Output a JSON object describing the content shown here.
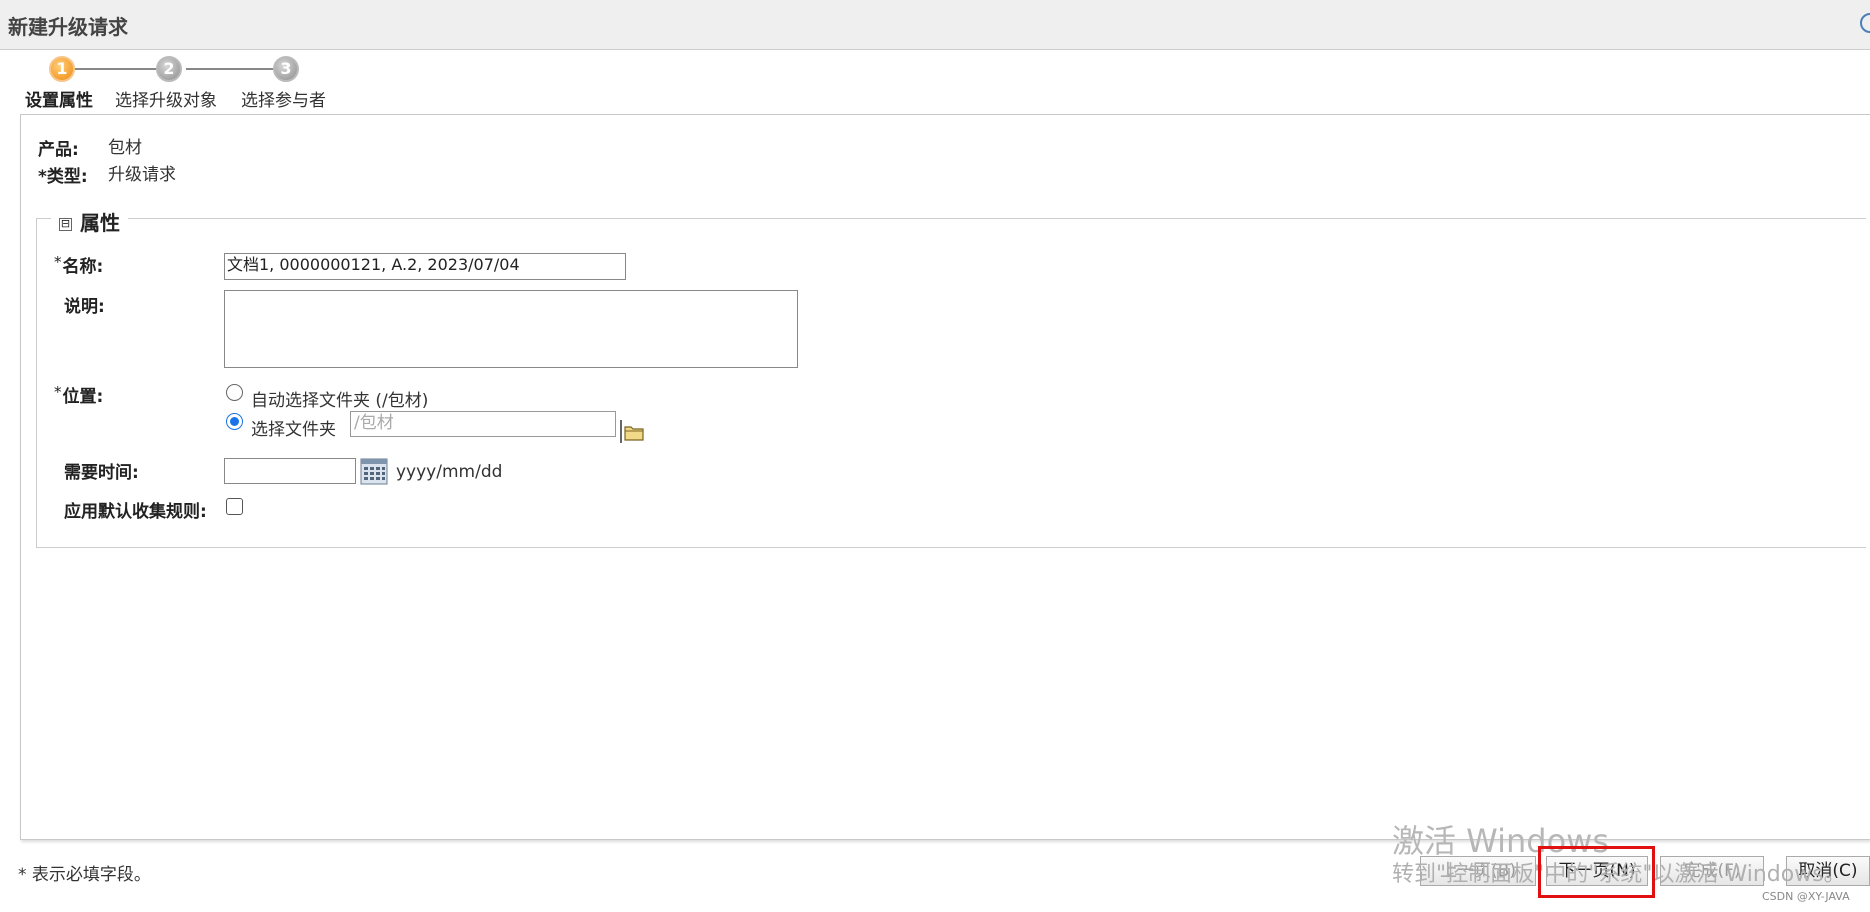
{
  "window": {
    "title": "新建升级请求"
  },
  "steps": [
    {
      "number": "1",
      "label": "设置属性",
      "active": true
    },
    {
      "number": "2",
      "label": "选择升级对象",
      "active": false
    },
    {
      "number": "3",
      "label": "选择参与者",
      "active": false
    }
  ],
  "info": {
    "product_label": "产品:",
    "product_value": "包材",
    "type_required": "*",
    "type_label": "类型:",
    "type_value": "升级请求"
  },
  "attributes": {
    "legend_toggle": "⊟",
    "legend": "属性",
    "name_required": "*",
    "name_label": "名称:",
    "name_value": "文档1, 0000000121, A.2, 2023/07/04",
    "description_label": "说明:",
    "description_value": "",
    "location_required": "*",
    "location_label": "位置:",
    "location_auto_option": "自动选择文件夹 (/包材)",
    "location_select_option": "选择文件夹",
    "location_folder_placeholder": "/包材",
    "need_date_label": "需要时间:",
    "need_date_value": "",
    "date_format_hint": "yyyy/mm/dd",
    "default_rules_label": "应用默认收集规则:"
  },
  "footer": {
    "required_note": "* 表示必填字段。",
    "prev_button": "上一页(B)",
    "next_button": "下一页(N)",
    "finish_button": "完成(F)",
    "cancel_button": "取消(C)"
  },
  "watermark": {
    "line1": "激活 Windows",
    "line2": "转到\"控制面板\"中的\"系统\"以激活 Windows。"
  },
  "credit": "CSDN @XY-JAVA",
  "colors": {
    "active_step": "#f0890e",
    "inactive_step": "#8c8c8c",
    "highlight": "#e01010",
    "radio_checked": "#1a73e8"
  }
}
